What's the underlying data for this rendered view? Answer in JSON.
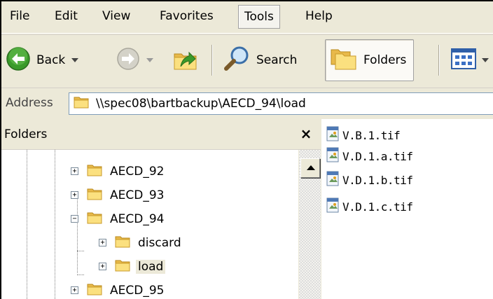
{
  "menubar": {
    "items": [
      "File",
      "Edit",
      "View",
      "Favorites",
      "Tools",
      "Help"
    ],
    "active": "Tools"
  },
  "toolbar": {
    "back_label": "Back",
    "search_label": "Search",
    "folders_label": "Folders"
  },
  "address": {
    "label": "Address",
    "path": "\\\\spec08\\bartbackup\\AECD_94\\load"
  },
  "folders_pane": {
    "title": "Folders",
    "close_glyph": "×",
    "nodes": [
      {
        "label": "AECD_92",
        "expander": "+"
      },
      {
        "label": "AECD_93",
        "expander": "+"
      },
      {
        "label": "AECD_94",
        "expander": "−"
      },
      {
        "label": "discard",
        "expander": "+"
      },
      {
        "label": "load",
        "expander": "+",
        "selected": true
      },
      {
        "label": "AECD_95",
        "expander": "+"
      }
    ]
  },
  "files": [
    "V.B.1.tif",
    "V.D.1.a.tif",
    "V.D.1.b.tif",
    "V.D.1.c.tif"
  ],
  "icons": {
    "back": "green-back-arrow-icon",
    "forward": "forward-arrow-icon",
    "up": "up-folder-icon",
    "search": "magnifier-icon",
    "folders": "folders-icon",
    "views": "views-icon",
    "folder": "folder-icon",
    "file": "tif-image-file-icon"
  },
  "colors": {
    "chrome": "#ece9d8",
    "back_green": "#3a9a2a",
    "folder_yellow": "#f6d66a",
    "address_border": "#7f9db9"
  }
}
